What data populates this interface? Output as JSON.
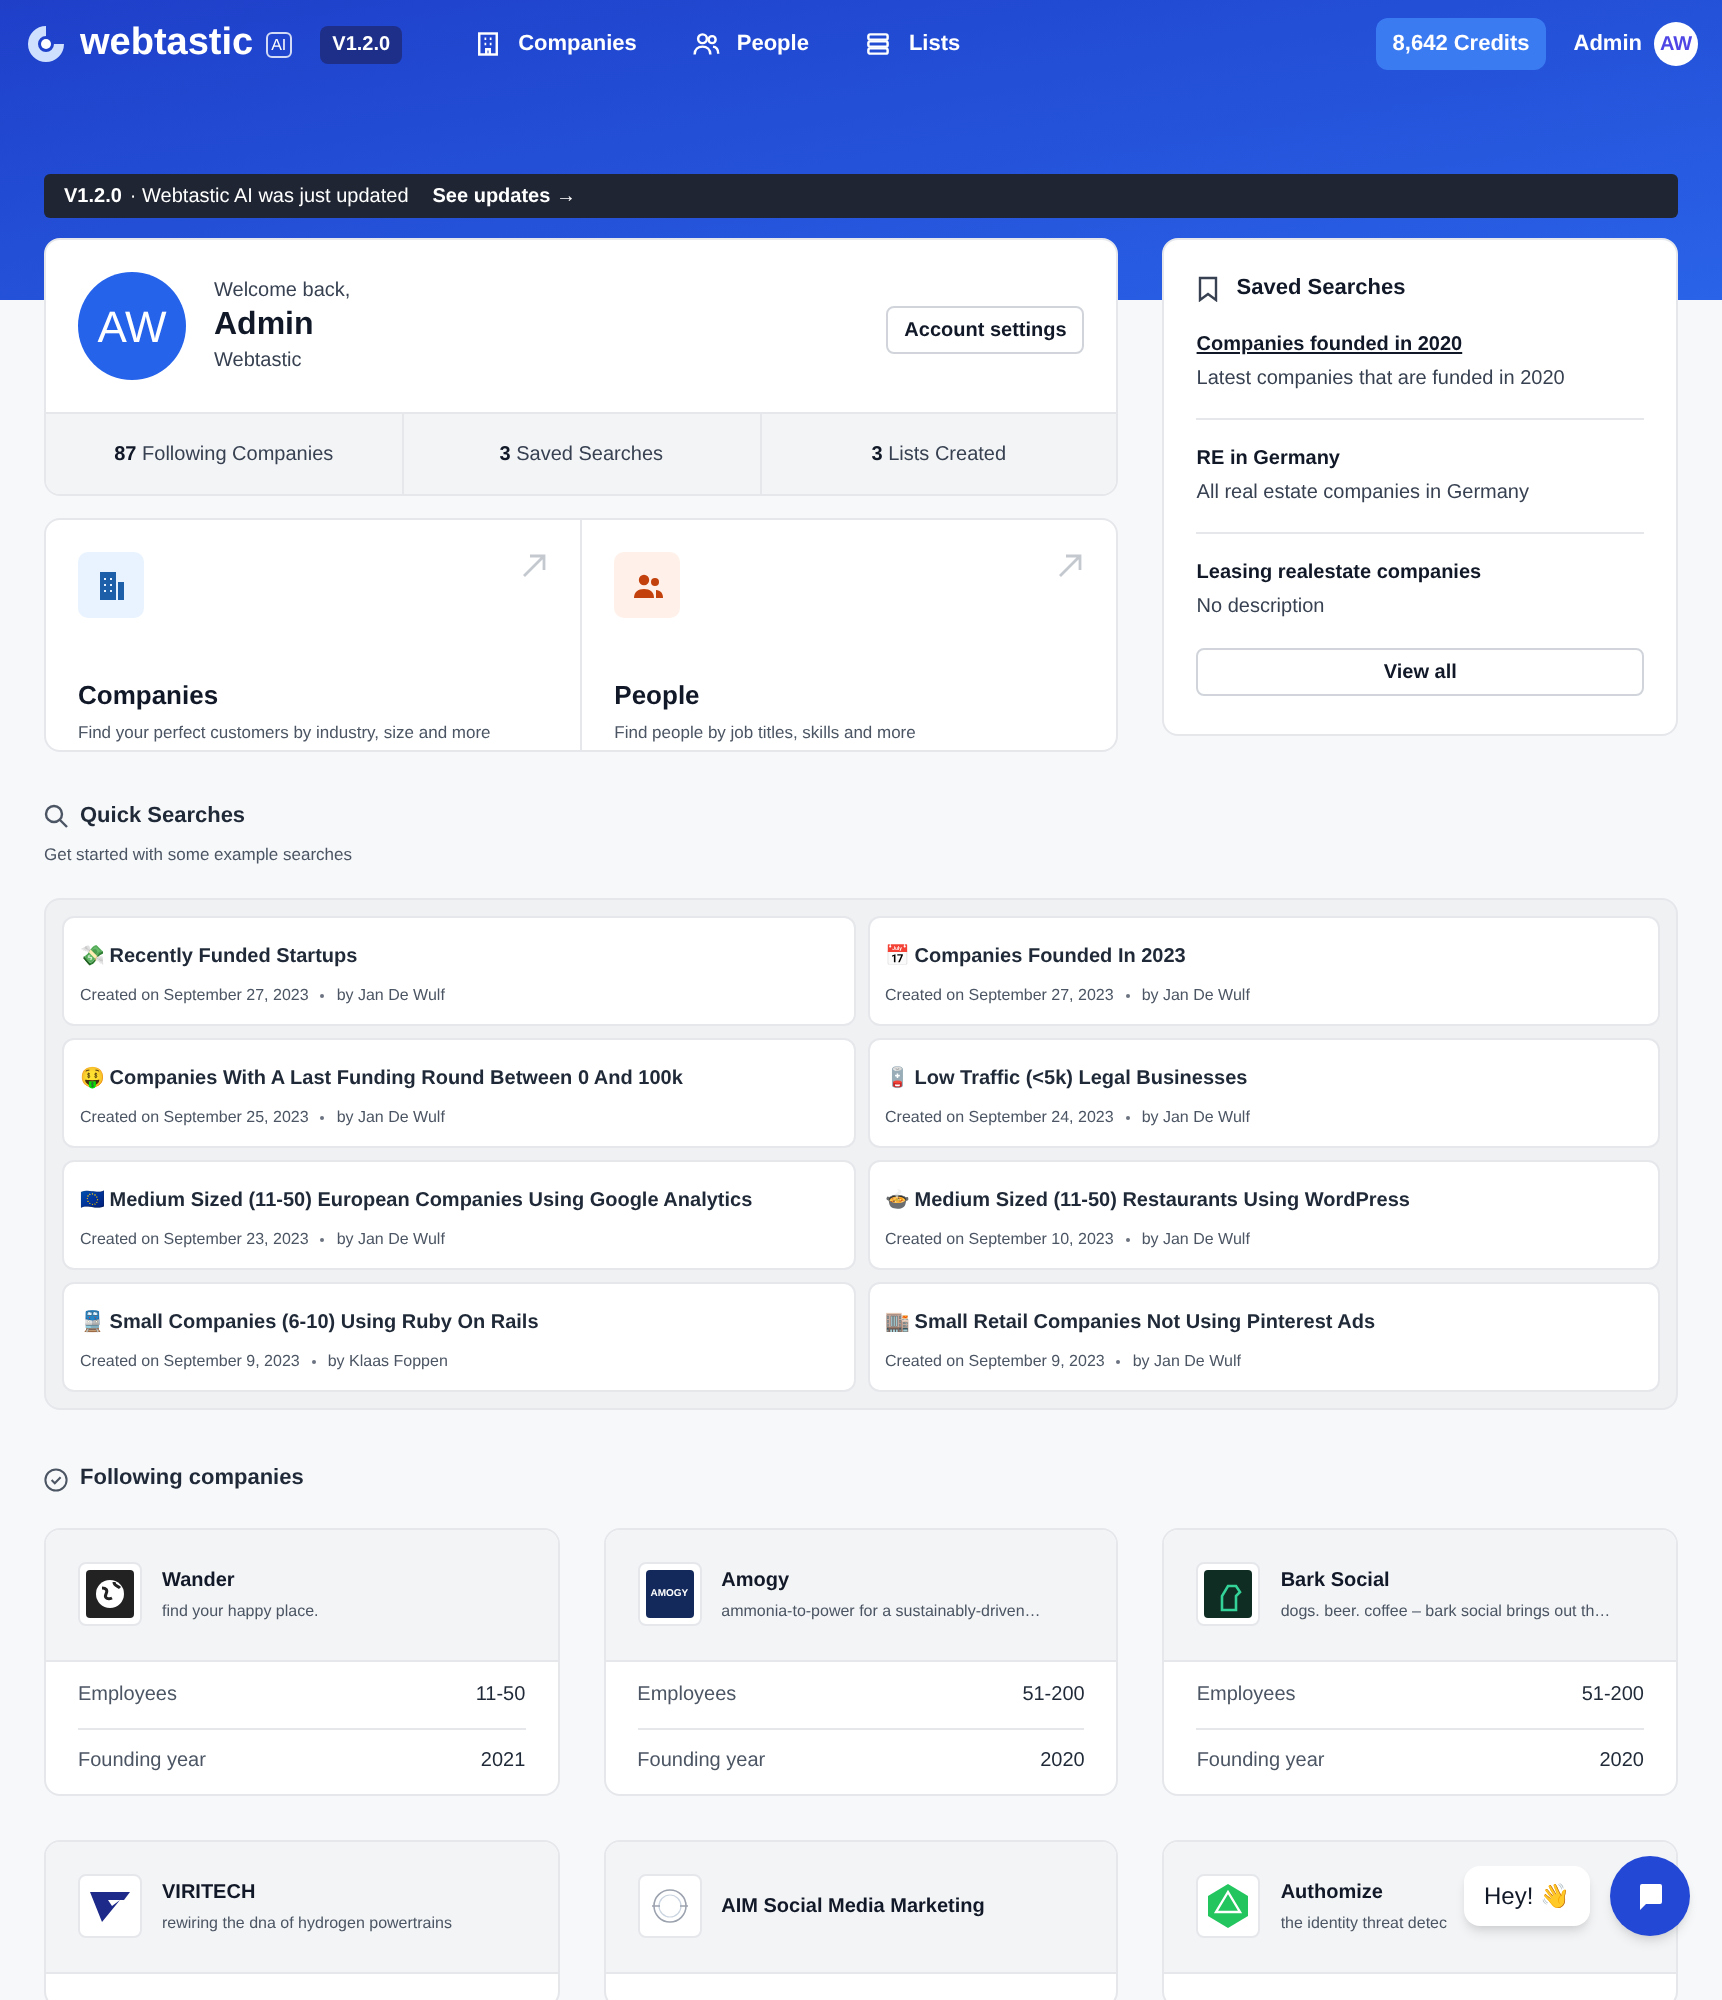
{
  "header": {
    "brand": "webtastic",
    "brand_badge": "AI",
    "version": "V1.2.0",
    "nav": [
      {
        "label": "Companies",
        "kind": "building"
      },
      {
        "label": "People",
        "kind": "people"
      },
      {
        "label": "Lists",
        "kind": "list"
      }
    ],
    "credits": "8,642 Credits",
    "user": "Admin",
    "avatar": "AW"
  },
  "banner": {
    "version": "V1.2.0",
    "message": "· Webtastic AI was just updated",
    "link": "See updates →"
  },
  "profile": {
    "avatar": "AW",
    "greeting": "Welcome back,",
    "name": "Admin",
    "company": "Webtastic",
    "button": "Account settings",
    "stats": [
      {
        "count": "87",
        "label": "Following Companies"
      },
      {
        "count": "3",
        "label": "Saved Searches"
      },
      {
        "count": "3",
        "label": "Lists Created"
      }
    ]
  },
  "shortcuts": [
    {
      "title": "Companies",
      "description": "Find your perfect customers by industry, size and more",
      "kind": "building"
    },
    {
      "title": "People",
      "description": "Find people by job titles, skills and more",
      "kind": "people"
    }
  ],
  "saved_searches": {
    "title": "Saved Searches",
    "items": [
      {
        "title": "Companies founded in 2020",
        "description": "Latest companies that are funded in 2020",
        "underlined": true
      },
      {
        "title": "RE in Germany",
        "description": "All real estate companies in Germany",
        "underlined": false
      },
      {
        "title": "Leasing realestate companies",
        "description": "No description",
        "underlined": false
      }
    ],
    "button": "View all"
  },
  "quick_searches": {
    "title": "Quick Searches",
    "subtitle": "Get started with some example searches",
    "items": [
      {
        "title": "💸 Recently Funded Startups",
        "date": "Created on September 27, 2023",
        "author": "by Jan De Wulf"
      },
      {
        "title": "📅 Companies Founded In 2023",
        "date": "Created on September 27, 2023",
        "author": "by Jan De Wulf"
      },
      {
        "title": "🤑 Companies With A Last Funding Round Between 0 And 100k",
        "date": "Created on September 25, 2023",
        "author": "by Jan De Wulf"
      },
      {
        "title": "🪫 Low Traffic (<5k) Legal Businesses",
        "date": "Created on September 24, 2023",
        "author": "by Jan De Wulf"
      },
      {
        "title": "🇪🇺 Medium Sized (11-50) European Companies Using Google Analytics",
        "date": "Created on September 23, 2023",
        "author": "by Jan De Wulf"
      },
      {
        "title": "🍲 Medium Sized (11-50) Restaurants Using WordPress",
        "date": "Created on September 10, 2023",
        "author": "by Jan De Wulf"
      },
      {
        "title": "🚆 Small Companies (6-10) Using Ruby On Rails",
        "date": "Created on September 9, 2023",
        "author": "by Klaas Foppen"
      },
      {
        "title": "🏬 Small Retail Companies Not Using Pinterest Ads",
        "date": "Created on September 9, 2023",
        "author": "by Jan De Wulf"
      }
    ]
  },
  "following": {
    "title": "Following companies",
    "companies": [
      {
        "name": "Wander",
        "tagline": "find your happy place.",
        "kind": "globe",
        "fields": [
          {
            "label": "Employees",
            "value": "11-50"
          },
          {
            "label": "Founding year",
            "value": "2021"
          }
        ]
      },
      {
        "name": "Amogy",
        "tagline": "ammonia-to-power for a sustainably-driven…",
        "kind": "wordmark",
        "logo_text": "AMOGY",
        "fields": [
          {
            "label": "Employees",
            "value": "51-200"
          },
          {
            "label": "Founding year",
            "value": "2020"
          }
        ]
      },
      {
        "name": "Bark Social",
        "tagline": "dogs. beer. coffee – bark social brings out th…",
        "kind": "dog",
        "fields": [
          {
            "label": "Employees",
            "value": "51-200"
          },
          {
            "label": "Founding year",
            "value": "2020"
          }
        ]
      },
      {
        "name": "VIRITECH",
        "tagline": "rewiring the dna of hydrogen powertrains",
        "kind": "v"
      },
      {
        "name": "AIM Social Media Marketing",
        "kind": "seal"
      },
      {
        "name": "Authomize",
        "tagline": "the identity threat detec",
        "kind": "hex"
      }
    ]
  },
  "chat": {
    "greeting": "Hey! 👋"
  }
}
